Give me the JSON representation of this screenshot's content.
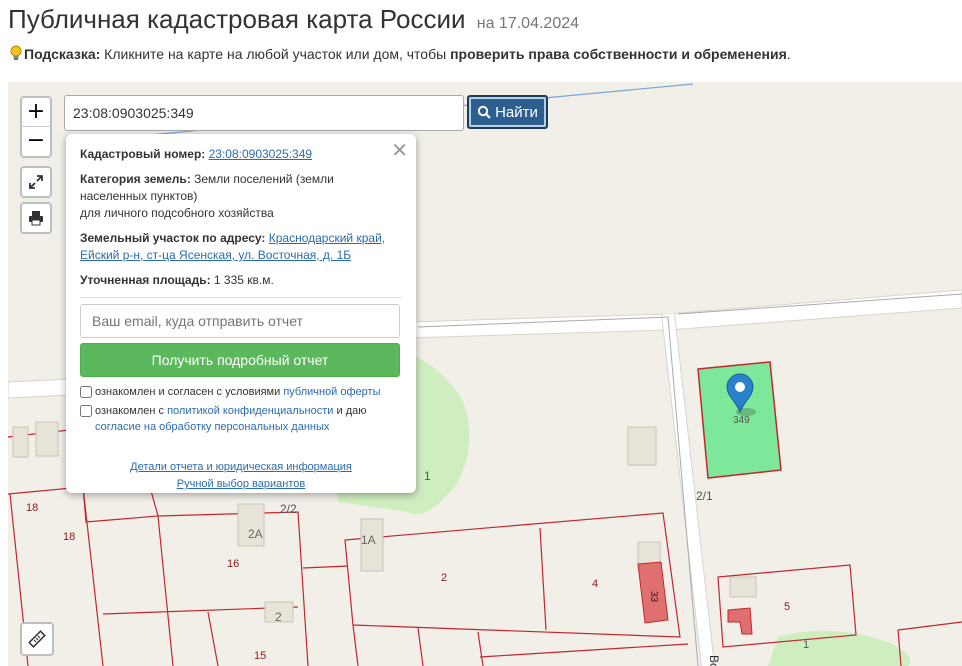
{
  "header": {
    "title": "Публичная кадастровая карта России",
    "date": "на 17.04.2024"
  },
  "hint": {
    "label": "Подсказка:",
    "text": " Кликните на карте на любой участок или дом, чтобы ",
    "bold": "проверить права собственности и обременения",
    "end": "."
  },
  "search": {
    "value": "23:08:0903025:349",
    "button_label": "Найти"
  },
  "map_controls": {
    "zoom_in": "+",
    "zoom_out": "−"
  },
  "popup": {
    "cadastral_label": "Кадастровый номер:",
    "cadastral_value": "23:08:0903025:349",
    "category_label": "Категория земель:",
    "category_value_1": " Земли поселений (земли населенных пунктов)",
    "category_value_2": "для личного подсобного хозяйства",
    "address_label": "Земельный участок по адресу:",
    "address_value": "Краснодарский край, Ейский р-н, ст-ца Ясенская, ул. Восточная, д. 1Б",
    "area_label": "Уточненная площадь:",
    "area_value": " 1 335 кв.м.",
    "email_placeholder": "Ваш email, куда отправить отчет",
    "report_button": "Получить подробный отчет",
    "agree_1_text": "ознакомлен и согласен с условиями ",
    "agree_1_link": "публичной оферты",
    "agree_2_text": "ознакомлен с ",
    "agree_2_link": "политикой конфиденциальности",
    "agree_2_mid": " и даю ",
    "agree_2_link2": "согласие на обработку персональных данных",
    "details_link": "Детали отчета и юридическая информация",
    "manual_link": "Ручной выбор вариантов"
  },
  "map_labels": {
    "plot_349": "349",
    "l_18a": "18",
    "l_18b": "18",
    "l_16": "16",
    "l_2a": "2А",
    "l_22": "2/2",
    "l_2": "2",
    "l_15": "15",
    "l_1a": "1А",
    "l_2b": "2",
    "l_4": "4",
    "l_33": "33",
    "l_1": "1",
    "l_21": "2/1",
    "l_5": "5",
    "l_1b": "1",
    "l_bo": "Во"
  },
  "colors": {
    "accent_button": "#2c5f8f",
    "report_button": "#5cb85c",
    "selected_plot": "#7ee89a",
    "parcel_border": "#c0282d",
    "marker": "#2a81cb"
  }
}
